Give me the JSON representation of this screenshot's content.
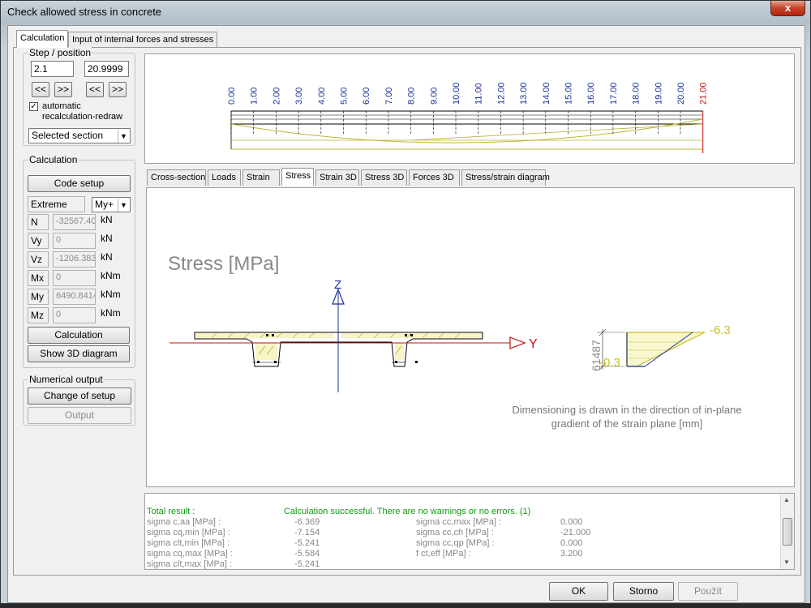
{
  "window": {
    "title": "Check allowed stress in concrete",
    "close_label": "x"
  },
  "tabs": [
    "Calculation",
    "Input of internal forces and stresses"
  ],
  "step_position": {
    "group_label": "Step / position",
    "step_value": "2.1",
    "position_value": "20.9999",
    "nav_buttons": [
      "<<",
      ">>",
      "<<",
      ">>"
    ],
    "auto_checkbox_checked": true,
    "auto_label_line1": "automatic",
    "auto_label_line2": "recalculation-redraw",
    "section_select": "Selected section"
  },
  "calculation": {
    "group_label": "Calculation",
    "code_setup": "Code setup",
    "extreme_label": "Extreme",
    "extreme_select": "My+",
    "forces": [
      {
        "name": "N",
        "value": "-32567.40",
        "unit": "kN"
      },
      {
        "name": "Vy",
        "value": "0",
        "unit": "kN"
      },
      {
        "name": "Vz",
        "value": "-1206.383",
        "unit": "kN"
      },
      {
        "name": "Mx",
        "value": "0",
        "unit": "kNm"
      },
      {
        "name": "My",
        "value": "6490.8414",
        "unit": "kNm"
      },
      {
        "name": "Mz",
        "value": "0",
        "unit": "kNm"
      }
    ],
    "calculation_button": "Calculation",
    "show3d_button": "Show 3D diagram"
  },
  "numerical_output": {
    "group_label": "Numerical output",
    "change_setup": "Change of setup",
    "output": "Output"
  },
  "beam_view": {
    "stations": [
      "0.00",
      "1.00",
      "2.00",
      "3.00",
      "4.00",
      "5.00",
      "6.00",
      "7.00",
      "8.00",
      "9.00",
      "10.00",
      "11.00",
      "12.00",
      "13.00",
      "14.00",
      "15.00",
      "16.00",
      "17.00",
      "18.00",
      "19.00",
      "20.00",
      "21.00"
    ],
    "station_color": "#1b2fa0",
    "current_color": "#c01010"
  },
  "view_tabs": [
    "Cross-section",
    "Loads",
    "Strain",
    "Stress",
    "Strain 3D",
    "Stress 3D",
    "Forces 3D",
    "Stress/strain diagram"
  ],
  "active_view_tab": "Stress",
  "diagram": {
    "title": "Stress [MPa]",
    "axis_z": "Z",
    "axis_y": "Y",
    "top_value": "-6.3",
    "bottom_value": "-0.3",
    "dim_value": "61487",
    "note_line1": "Dimensioning is drawn in the direction of in-plane",
    "note_line2": "gradient of the strain plane [mm]"
  },
  "results": {
    "total_label": "Total result :",
    "status": "Calculation successful. There are no warnings or no errors. (1)",
    "left": [
      {
        "name": "sigma c,aa [MPa] :",
        "value": "-6.369"
      },
      {
        "name": "sigma cq,min [MPa] :",
        "value": "-7.154"
      },
      {
        "name": "sigma clt,min [MPa] :",
        "value": "-5.241"
      },
      {
        "name": "sigma cq,max [MPa] :",
        "value": "-5.584"
      },
      {
        "name": "sigma clt,max [MPa] :",
        "value": "-5.241"
      }
    ],
    "right": [
      {
        "name": "sigma cc,max [MPa] :",
        "value": "0.000"
      },
      {
        "name": "sigma cc,ch [MPa] :",
        "value": "-21.000"
      },
      {
        "name": "sigma cc,qp [MPa] :",
        "value": "0.000"
      },
      {
        "name": "f ct,eff [MPa] :",
        "value": "3.200"
      }
    ]
  },
  "dialog_buttons": {
    "ok": "OK",
    "storno": "Storno",
    "apply": "Použít"
  }
}
